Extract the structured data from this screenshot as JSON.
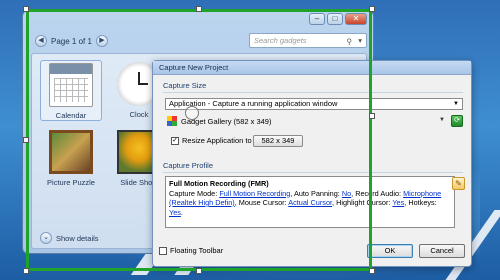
{
  "gallery": {
    "page_label": "Page 1 of 1",
    "search_placeholder": "Search gadgets",
    "gadgets": [
      {
        "label": "Calendar"
      },
      {
        "label": "Clock"
      },
      {
        "label": "Picture Puzzle"
      },
      {
        "label": "Slide Show"
      }
    ],
    "show_details_label": "Show details"
  },
  "dialog": {
    "title": "Capture New Project",
    "capture_size_label": "Capture Size",
    "mode_value": "Application - Capture a running application window",
    "target_value": "Gadget Gallery  (582 x 349)",
    "resize_label": "Resize Application to",
    "resize_checked": true,
    "resize_value": "582 x 349",
    "capture_profile_label": "Capture Profile",
    "profile": {
      "title": "Full Motion Recording (FMR)",
      "capture_mode_label": "Capture Mode:",
      "capture_mode_value": "Full Motion Recording",
      "auto_panning_label": ", Auto Panning:",
      "auto_panning_value": "No",
      "record_audio_label": ", Record Audio:",
      "microphone_value": "Microphone (Realtek High Defin)",
      "mouse_cursor_label": ", Mouse Cursor:",
      "mouse_cursor_value": "Actual Cursor",
      "highlight_cursor_label": ", Highlight Cursor:",
      "highlight_cursor_value": "Yes",
      "hotkeys_label": ", Hotkeys:",
      "hotkeys_value": "Yes",
      "end": "."
    },
    "floating_toolbar_label": "Floating Toolbar",
    "ok_label": "OK",
    "cancel_label": "Cancel"
  },
  "colors": {
    "capture_frame": "#1ea42a",
    "link": "#0033cc",
    "desktop_blue": "#3f8ed2"
  }
}
